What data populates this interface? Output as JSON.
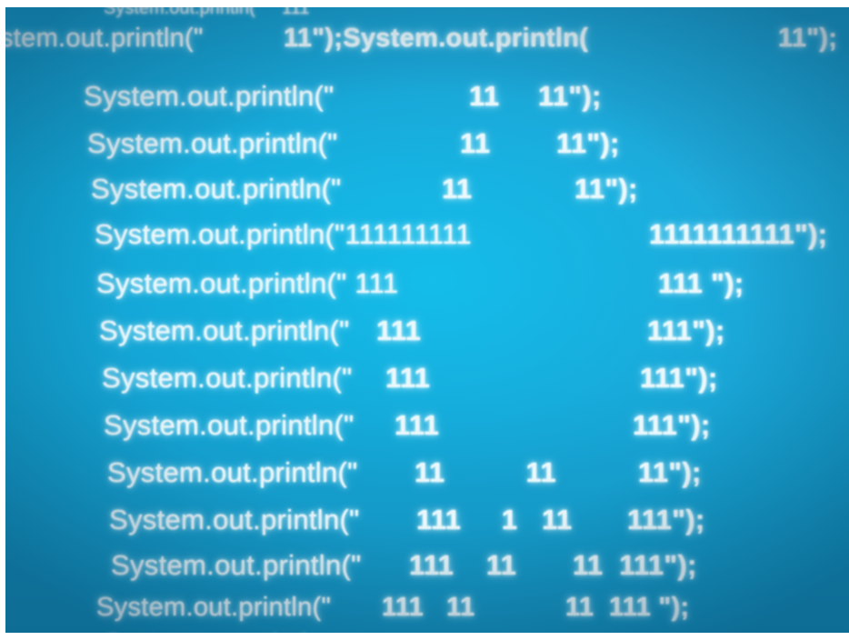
{
  "top_partial_line": "System.out.println(\"    111",
  "lines": [
    {
      "prefix": "stem.out.println(\"",
      "mid": "11\");System.out.println(",
      "right": "11\");"
    },
    {
      "prefix": "System.out.println(\"",
      "mid": "11",
      "right": "11\");"
    },
    {
      "prefix": "System.out.println(\"",
      "mid": "11",
      "right": "11\");"
    },
    {
      "prefix": "System.out.println(\"",
      "mid": "11",
      "right": "11\");"
    },
    {
      "prefix": "System.out.println(\"111111111",
      "mid": "",
      "right": "1111111111\");"
    },
    {
      "prefix": "System.out.println(\" 111",
      "mid": "",
      "right": "111 \");"
    },
    {
      "prefix": "System.out.println(\"",
      "mid": "111",
      "right": "111\");"
    },
    {
      "prefix": "System.out.println(\"",
      "mid": "111",
      "right": "111\");"
    },
    {
      "prefix": "System.out.println(\"",
      "mid": "111",
      "right": "111\");"
    },
    {
      "prefix": "System.out.println(\"",
      "mid": "11          11",
      "right": "11\");"
    },
    {
      "prefix": "System.out.println(\"",
      "mid": "111     1   11",
      "right": "111\");"
    },
    {
      "prefix": "System.out.println(\"",
      "mid": "111    11",
      "right": "11  111\");"
    },
    {
      "prefix": "System.out.println(\"",
      "mid": "111   11",
      "right": "11  111 \");"
    }
  ]
}
